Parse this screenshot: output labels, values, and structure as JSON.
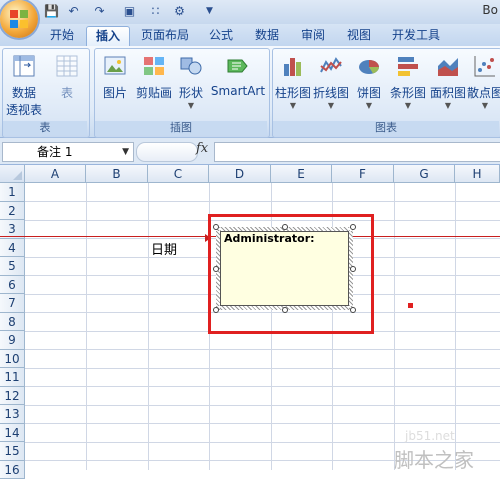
{
  "app": {
    "title_partial": "Bo"
  },
  "quick_access": {
    "icons": [
      "save-icon",
      "undo-icon",
      "redo-icon",
      "print-preview-icon",
      "customize-icon"
    ]
  },
  "tabs": [
    "开始",
    "插入",
    "页面布局",
    "公式",
    "数据",
    "审阅",
    "视图",
    "开发工具"
  ],
  "active_tab": "插入",
  "ribbon": {
    "table_group": {
      "label": "表",
      "items": [
        {
          "line1": "数据",
          "line2": "透视表"
        },
        {
          "line1": "表",
          "line2": ""
        }
      ]
    },
    "illustrations_group": {
      "label": "插图",
      "items": [
        "图片",
        "剪贴画",
        "形状",
        "SmartArt"
      ]
    },
    "charts_group": {
      "label": "图表",
      "items": [
        "柱形图",
        "折线图",
        "饼图",
        "条形图",
        "面积图",
        "散点图"
      ]
    }
  },
  "formula_bar": {
    "name_box": "备注 1",
    "fx_label": "fx",
    "content": ""
  },
  "columns": [
    "A",
    "B",
    "C",
    "D",
    "E",
    "F",
    "G",
    "H"
  ],
  "rows": [
    "1",
    "2",
    "3",
    "4",
    "5",
    "6",
    "7",
    "8",
    "9",
    "10",
    "11",
    "12",
    "13",
    "14",
    "15",
    "16"
  ],
  "cells": {
    "C4": "日期"
  },
  "comment": {
    "author": "Administrator:",
    "text": ""
  },
  "watermark": {
    "url": "jb51.net",
    "brand": "脚本之家"
  },
  "colors": {
    "highlight": "#e02020",
    "comment_bg": "#ffffe1",
    "ribbon_bg": "#dfe9f6"
  }
}
